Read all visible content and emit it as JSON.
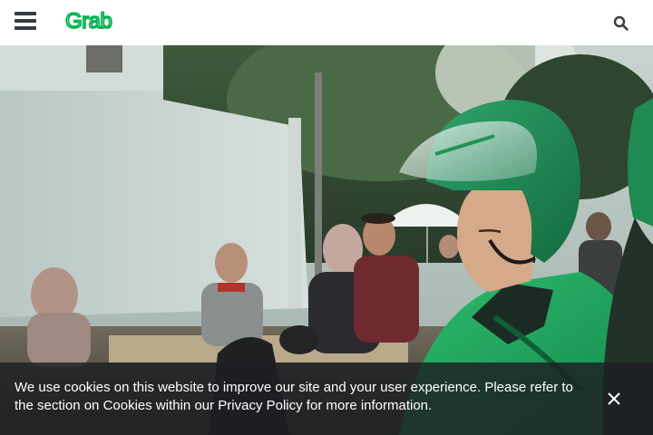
{
  "header": {
    "menu_icon": "hamburger-menu-icon",
    "logo_text": "Grab",
    "logo_color": "#00b14f",
    "search_icon": "search-icon"
  },
  "hero": {
    "image_subject": "Grab driver in green helmet and jacket at a street market"
  },
  "cookie_banner": {
    "message": "We use cookies on this website to improve our site and your user experience. Please refer to the section on Cookies within our Privacy Policy for more information.",
    "close_icon": "close-icon"
  },
  "colors": {
    "brand_green": "#00b14f",
    "header_icon": "#363a45",
    "banner_bg": "#1c1e22"
  }
}
